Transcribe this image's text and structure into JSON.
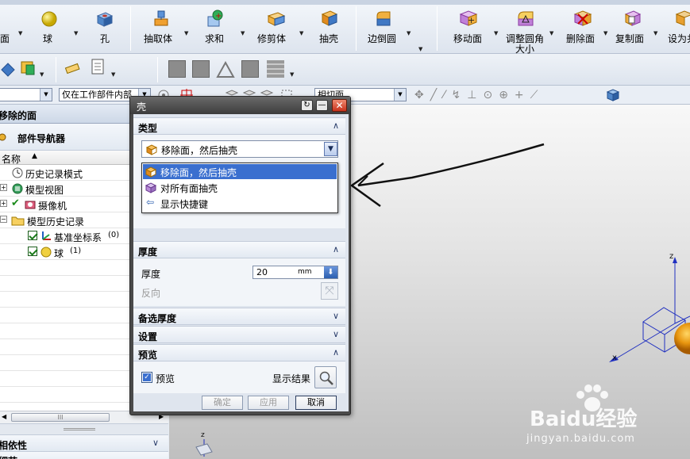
{
  "toolbar_row1": {
    "items": [
      {
        "label": "面",
        "icon": "face-icon"
      },
      {
        "label": "球",
        "icon": "sphere-icon"
      },
      {
        "label": "孔",
        "icon": "hole-icon"
      },
      {
        "label": "抽取体",
        "icon": "extract-body-icon"
      },
      {
        "label": "求和",
        "icon": "unite-icon"
      },
      {
        "label": "修剪体",
        "icon": "trim-body-icon"
      },
      {
        "label": "抽壳",
        "icon": "shell-icon"
      },
      {
        "label": "边倒圆",
        "icon": "edge-blend-icon"
      },
      {
        "label": "移动面",
        "icon": "move-face-icon"
      },
      {
        "label": "调整圆角大小",
        "label_line1": "调整圆角",
        "label_line2": "大小",
        "icon": "resize-blend-icon"
      },
      {
        "label": "删除面",
        "icon": "delete-face-icon"
      },
      {
        "label": "复制面",
        "icon": "copy-face-icon"
      },
      {
        "label": "设为共",
        "icon": "set-face-icon"
      }
    ]
  },
  "selection_bar": {
    "filter_value": "仅在工作部件内部",
    "face_rule_value": "相切面"
  },
  "left_panel": {
    "title": "移除的面",
    "navigator_title": "部件导航器",
    "column_header": "名称",
    "tree": [
      {
        "label": "历史记录模式",
        "icon": "clock-icon"
      },
      {
        "label": "模型视图",
        "icon": "model-views-icon"
      },
      {
        "label": "摄像机",
        "icon": "camera-icon"
      },
      {
        "label": "模型历史记录",
        "icon": "folder-icon"
      },
      {
        "label": "基准坐标系",
        "suffix": "(0)",
        "icon": "datum-csys-icon"
      },
      {
        "label": "球",
        "suffix": "(1)",
        "icon": "sphere-icon"
      }
    ],
    "dependency_title": "相依性",
    "details_title": "细节"
  },
  "dialog": {
    "title": "壳",
    "type_section": "类型",
    "type_selected": "移除面，然后抽壳",
    "type_options": [
      "移除面，然后抽壳",
      "对所有面抽壳",
      "显示快捷键"
    ],
    "thickness_section": "厚度",
    "thickness_label": "厚度",
    "thickness_value": "20",
    "thickness_unit": "mm",
    "reverse_label": "反向",
    "alt_thickness_section": "备选厚度",
    "settings_section": "设置",
    "preview_section": "预览",
    "preview_checkbox": "预览",
    "show_result": "显示结果",
    "ok": "确定",
    "apply": "应用",
    "cancel": "取消"
  },
  "viewport": {
    "axis_z": "z",
    "axis_x": "x",
    "axis_z2": "z"
  },
  "watermark": {
    "brand": "Baidu经验",
    "url": "jingyan.baidu.com"
  }
}
